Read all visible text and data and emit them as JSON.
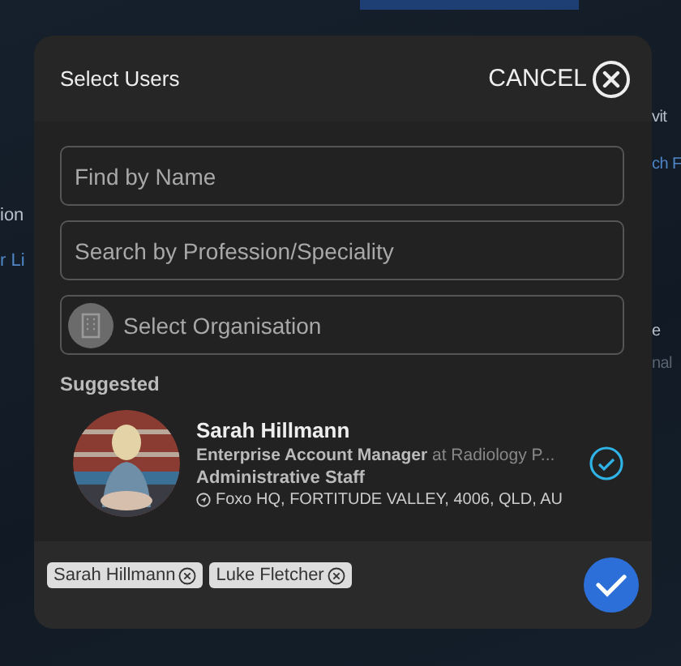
{
  "background_fragments": {
    "left": [
      "ion",
      "r Li"
    ],
    "right": [
      "vit",
      "ch F",
      "e",
      "nal"
    ]
  },
  "dialog": {
    "title": "Select Users",
    "cancel": "CANCEL"
  },
  "fields": [
    {
      "placeholder": "Find by Name",
      "kind": "text"
    },
    {
      "placeholder": "Search by Profession/Speciality",
      "kind": "text"
    },
    {
      "placeholder": "Select Organisation",
      "kind": "organisation"
    }
  ],
  "suggested_label": "Suggested",
  "users": [
    {
      "name": "Sarah Hillmann",
      "role": "Enterprise Account Manager",
      "organisation": "at Radiology P...",
      "category": "Administrative Staff",
      "location": "Foxo HQ, FORTITUDE VALLEY, 4006, QLD, AU",
      "selected": true
    }
  ],
  "chips": [
    "Sarah Hillmann",
    "Luke Fletcher"
  ]
}
